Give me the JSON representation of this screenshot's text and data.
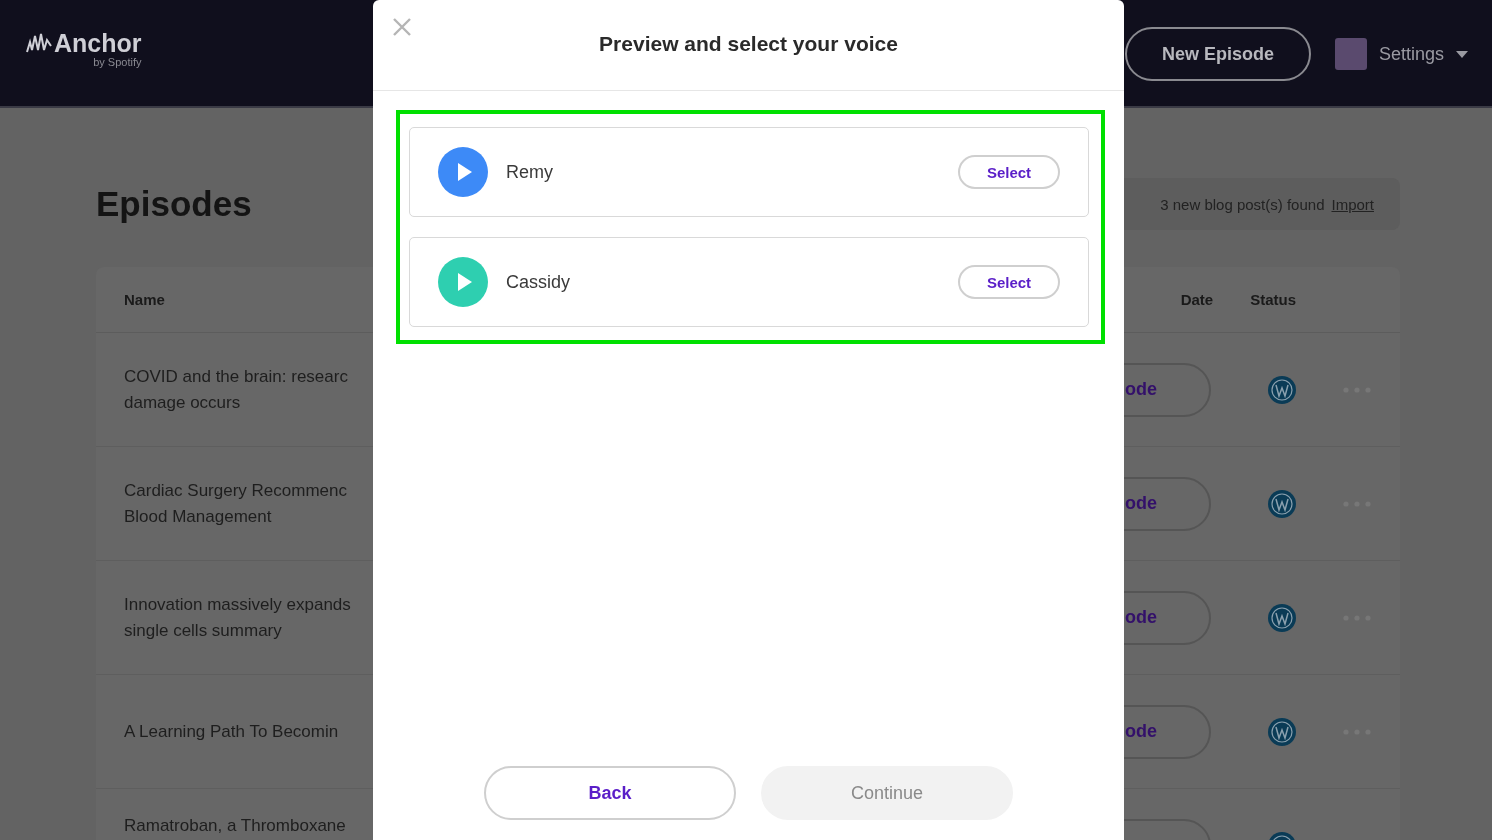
{
  "header": {
    "logo": "Anchor",
    "logo_sub": "by Spotify",
    "new_episode": "New Episode",
    "settings": "Settings"
  },
  "page": {
    "title": "Episodes",
    "notice": {
      "text": "3 new blog post(s) found",
      "link": "Import"
    }
  },
  "table": {
    "columns": [
      "Name",
      "Date",
      "Status"
    ],
    "rows": [
      {
        "name_lines": [
          "COVID and the brain: researc",
          "damage occurs"
        ],
        "action": "ode"
      },
      {
        "name_lines": [
          "Cardiac Surgery Recommenc",
          "Blood Management"
        ],
        "action": "ode"
      },
      {
        "name_lines": [
          "Innovation massively expands",
          "single cells summary"
        ],
        "action": "ode"
      },
      {
        "name_lines": [
          "A Learning Path To Becomin"
        ],
        "action": "ode"
      },
      {
        "name_lines": [
          "Ramatroban, a Thromboxane"
        ]
      }
    ]
  },
  "modal": {
    "title": "Preview and select your voice",
    "voices": [
      {
        "name": "Remy",
        "color": "#3d8af7",
        "button": "Select"
      },
      {
        "name": "Cassidy",
        "color": "#2ecfb0",
        "button": "Select"
      }
    ],
    "back": "Back",
    "continue": {
      "label": "Continue",
      "disabled": true
    }
  }
}
